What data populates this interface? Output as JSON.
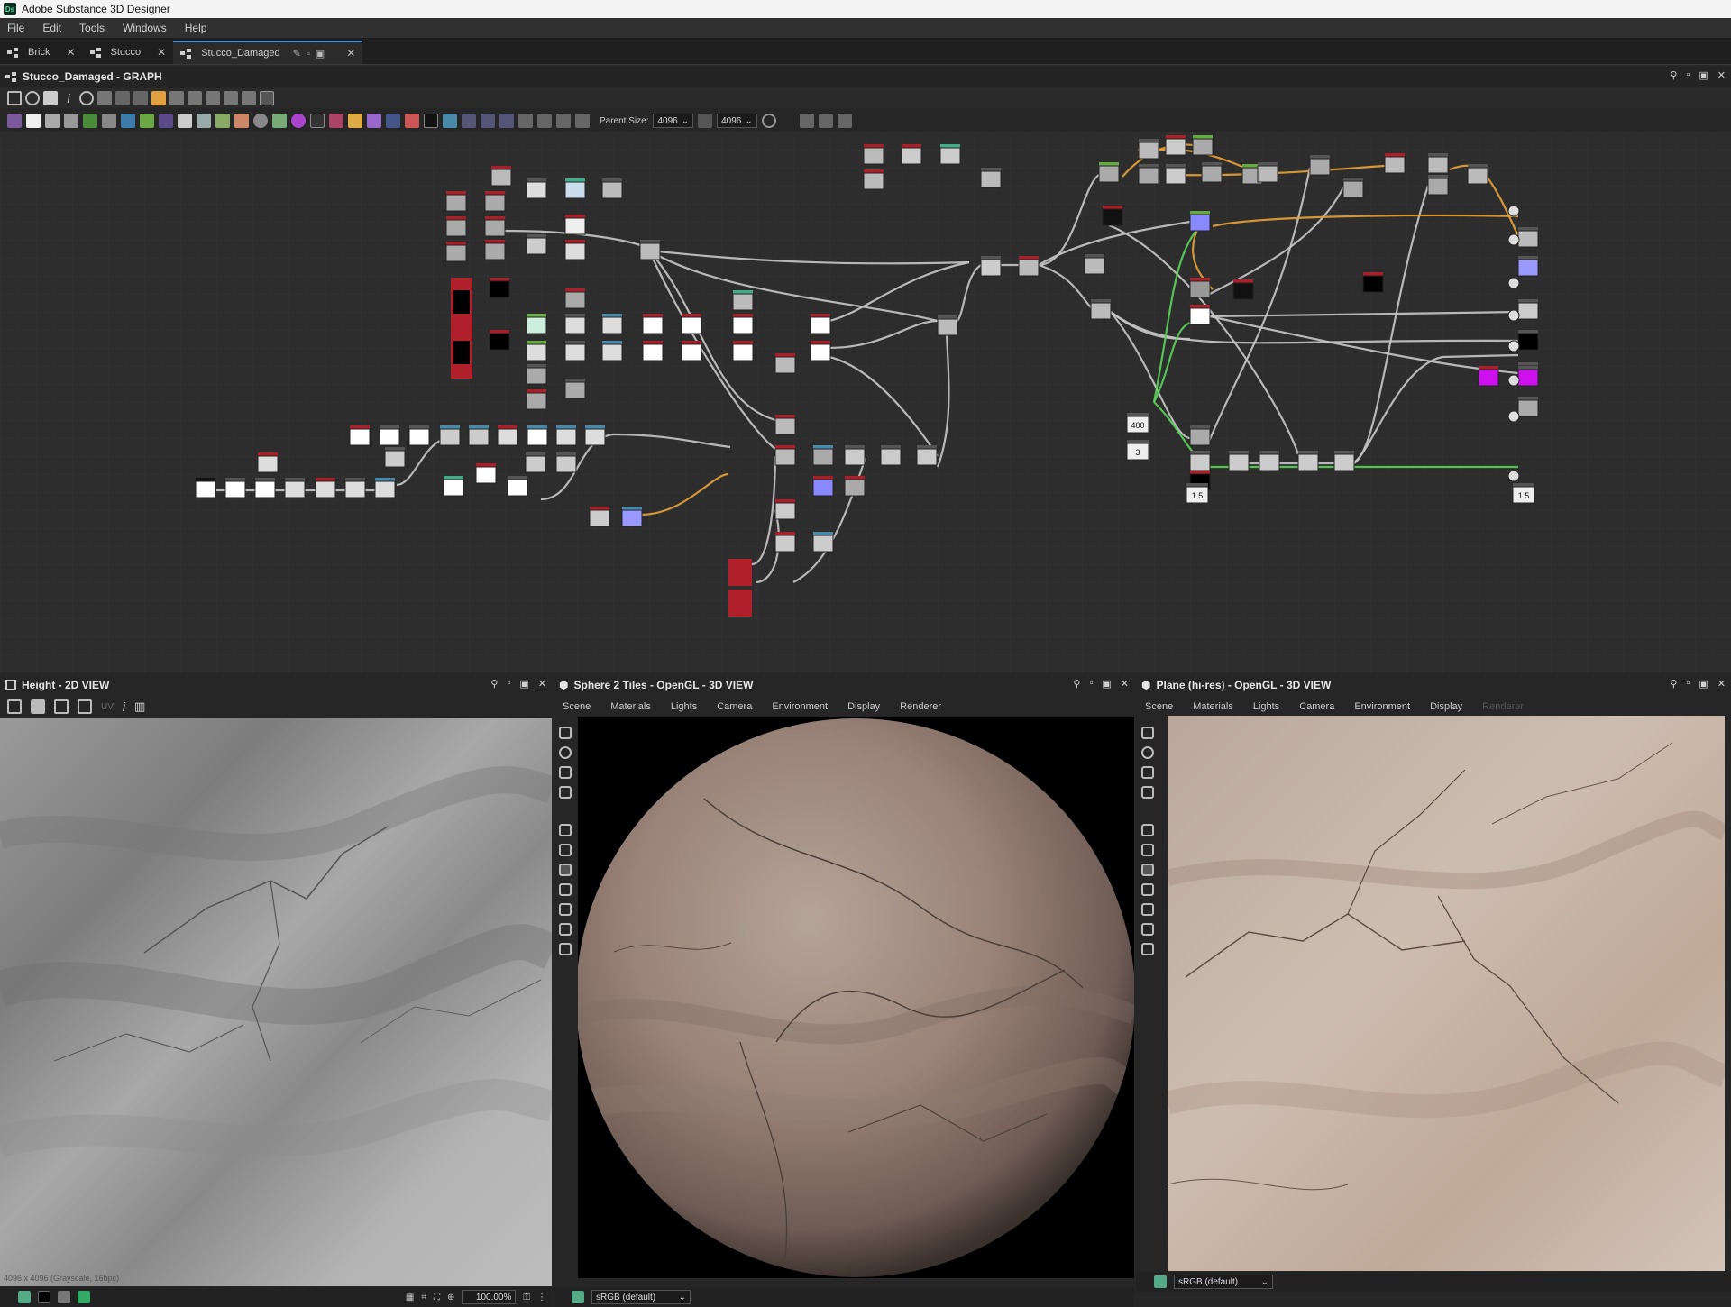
{
  "app": {
    "title": "Adobe Substance 3D Designer",
    "logo": "Ds"
  },
  "menu": [
    "File",
    "Edit",
    "Tools",
    "Windows",
    "Help"
  ],
  "tabs": [
    {
      "label": "Brick",
      "active": false
    },
    {
      "label": "Stucco",
      "active": false
    },
    {
      "label": "Stucco_Damaged",
      "active": true
    }
  ],
  "graph": {
    "title": "Stucco_Damaged - GRAPH",
    "parent_size_label": "Parent Size:",
    "parent_size_value": "4096",
    "size_value_2": "4096",
    "value_nodes": [
      "400",
      "3",
      "1.5",
      "1.5"
    ]
  },
  "view2d": {
    "title": "Height - 2D VIEW",
    "uv_label": "UV",
    "info": "4096 x 4096 (Grayscale, 16bpc)",
    "zoom": "100.00%"
  },
  "view3d_sphere": {
    "title": "Sphere 2 Tiles - OpenGL - 3D VIEW",
    "menu": [
      "Scene",
      "Materials",
      "Lights",
      "Camera",
      "Environment",
      "Display",
      "Renderer"
    ],
    "colorspace": "sRGB (default)"
  },
  "view3d_plane": {
    "title": "Plane (hi-res) - OpenGL - 3D VIEW",
    "menu": [
      "Scene",
      "Materials",
      "Lights",
      "Camera",
      "Environment",
      "Display",
      "Renderer"
    ],
    "colorspace": "sRGB (default)"
  },
  "colors": {
    "accent": "#4a90d9",
    "link_orange": "#e8a23a",
    "link_green": "#5bd35b",
    "node_header": "#a8202a"
  }
}
